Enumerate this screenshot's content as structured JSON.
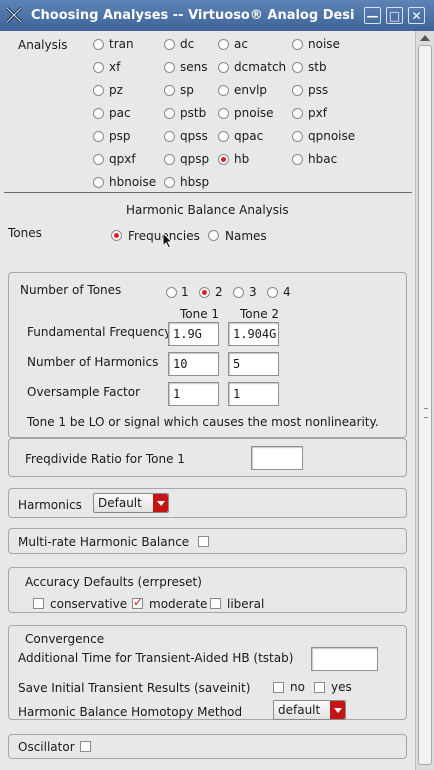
{
  "window": {
    "title": "Choosing Analyses -- Virtuoso® Analog Desi",
    "minimize": "—",
    "maximize": "□",
    "close": "✕"
  },
  "analysis": {
    "label": "Analysis",
    "options": [
      [
        "tran",
        "dc",
        "ac",
        "noise"
      ],
      [
        "xf",
        "sens",
        "dcmatch",
        "stb"
      ],
      [
        "pz",
        "sp",
        "envlp",
        "pss"
      ],
      [
        "pac",
        "pstb",
        "pnoise",
        "pxf"
      ],
      [
        "psp",
        "qpss",
        "qpac",
        "qpnoise"
      ],
      [
        "qpxf",
        "qpsp",
        "hb",
        "hbac"
      ],
      [
        "hbnoise",
        "hbsp"
      ]
    ],
    "selected": "hb"
  },
  "hb": {
    "heading": "Harmonic Balance Analysis",
    "tones_label": "Tones",
    "tones_options": [
      "Frequencies",
      "Names"
    ],
    "tones_selected": "Frequencies",
    "num_tones_label": "Number of Tones",
    "num_tones_options": [
      "1",
      "2",
      "3",
      "4"
    ],
    "num_tones_selected": "2",
    "tone1_header": "Tone 1",
    "tone2_header": "Tone 2",
    "fund_freq_label": "Fundamental Frequency",
    "fund_freq": [
      "1.9G",
      "1.904G"
    ],
    "num_harmonics_label": "Number of Harmonics",
    "num_harmonics": [
      "10",
      "5"
    ],
    "oversample_label": "Oversample Factor",
    "oversample": [
      "1",
      "1"
    ],
    "tone_note": "Tone 1 be LO or signal which causes the most nonlinearity.",
    "freqdivide_label": "Freqdivide Ratio for Tone 1",
    "freqdivide_value": ""
  },
  "harmonics": {
    "label": "Harmonics",
    "value": "Default"
  },
  "multirate": {
    "label": "Multi-rate Harmonic Balance",
    "checked": false
  },
  "accuracy": {
    "label": "Accuracy Defaults (errpreset)",
    "options": [
      "conservative",
      "moderate",
      "liberal"
    ],
    "selected": "moderate"
  },
  "convergence": {
    "label": "Convergence",
    "tstab_label": "Additional Time for Transient-Aided HB (tstab)",
    "tstab_value": "",
    "saveinit_label": "Save Initial Transient Results (saveinit)",
    "saveinit_options": [
      "no",
      "yes"
    ],
    "homotopy_label": "Harmonic Balance Homotopy Method",
    "homotopy_value": "default"
  },
  "oscillator": {
    "label": "Oscillator",
    "checked": false
  },
  "colors": {
    "titlebar": "#4a6ea4",
    "radio_selected": "#d42020",
    "dropdown": "#c41414"
  }
}
